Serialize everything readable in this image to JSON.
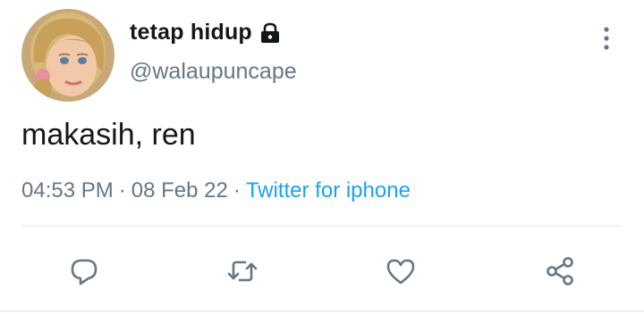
{
  "author": {
    "display_name": "tetap hidup",
    "handle": "@walaupuncape",
    "avatar_icon": "cartoon-avatar",
    "protected_icon": "lock-icon"
  },
  "tweet": {
    "text": "makasih, ren"
  },
  "meta": {
    "time": "04:53 PM",
    "separator": "·",
    "date": "08 Feb 22",
    "source": "Twitter for iphone"
  },
  "actions": [
    {
      "name": "reply",
      "icon": "reply-icon"
    },
    {
      "name": "retweet",
      "icon": "retweet-icon"
    },
    {
      "name": "like",
      "icon": "heart-icon"
    },
    {
      "name": "share",
      "icon": "share-icon"
    }
  ],
  "colors": {
    "text_primary": "#14171a",
    "text_secondary": "#657786",
    "link": "#1da1f2",
    "divider": "#e1e8ed"
  }
}
